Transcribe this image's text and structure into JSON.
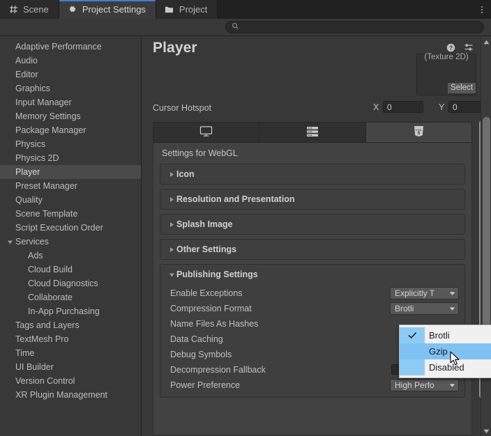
{
  "window": {
    "tabs": [
      {
        "label": "Scene",
        "icon": "grid-icon",
        "active": false
      },
      {
        "label": "Project Settings",
        "icon": "gear-icon",
        "active": true
      },
      {
        "label": "Project",
        "icon": "folder-icon",
        "active": false
      }
    ],
    "overflow_icon": "kebab-menu-icon"
  },
  "search": {
    "value": "",
    "placeholder": "",
    "icon": "search-icon"
  },
  "sidebar": {
    "items": [
      {
        "label": "Adaptive Performance",
        "indent": 0,
        "selected": false,
        "expandable": false
      },
      {
        "label": "Audio",
        "indent": 0,
        "selected": false,
        "expandable": false
      },
      {
        "label": "Editor",
        "indent": 0,
        "selected": false,
        "expandable": false
      },
      {
        "label": "Graphics",
        "indent": 0,
        "selected": false,
        "expandable": false
      },
      {
        "label": "Input Manager",
        "indent": 0,
        "selected": false,
        "expandable": false
      },
      {
        "label": "Memory Settings",
        "indent": 0,
        "selected": false,
        "expandable": false
      },
      {
        "label": "Package Manager",
        "indent": 0,
        "selected": false,
        "expandable": false
      },
      {
        "label": "Physics",
        "indent": 0,
        "selected": false,
        "expandable": false
      },
      {
        "label": "Physics 2D",
        "indent": 0,
        "selected": false,
        "expandable": false
      },
      {
        "label": "Player",
        "indent": 0,
        "selected": true,
        "expandable": false
      },
      {
        "label": "Preset Manager",
        "indent": 0,
        "selected": false,
        "expandable": false
      },
      {
        "label": "Quality",
        "indent": 0,
        "selected": false,
        "expandable": false
      },
      {
        "label": "Scene Template",
        "indent": 0,
        "selected": false,
        "expandable": false
      },
      {
        "label": "Script Execution Order",
        "indent": 0,
        "selected": false,
        "expandable": false
      },
      {
        "label": "Services",
        "indent": 0,
        "selected": false,
        "expandable": true,
        "expanded": true
      },
      {
        "label": "Ads",
        "indent": 1,
        "selected": false,
        "expandable": false
      },
      {
        "label": "Cloud Build",
        "indent": 1,
        "selected": false,
        "expandable": false
      },
      {
        "label": "Cloud Diagnostics",
        "indent": 1,
        "selected": false,
        "expandable": false
      },
      {
        "label": "Collaborate",
        "indent": 1,
        "selected": false,
        "expandable": false
      },
      {
        "label": "In-App Purchasing",
        "indent": 1,
        "selected": false,
        "expandable": false
      },
      {
        "label": "Tags and Layers",
        "indent": 0,
        "selected": false,
        "expandable": false
      },
      {
        "label": "TextMesh Pro",
        "indent": 0,
        "selected": false,
        "expandable": false
      },
      {
        "label": "Time",
        "indent": 0,
        "selected": false,
        "expandable": false
      },
      {
        "label": "UI Builder",
        "indent": 0,
        "selected": false,
        "expandable": false
      },
      {
        "label": "Version Control",
        "indent": 0,
        "selected": false,
        "expandable": false
      },
      {
        "label": "XR Plugin Management",
        "indent": 0,
        "selected": false,
        "expandable": false
      }
    ]
  },
  "main": {
    "title": "Player",
    "tools": [
      {
        "name": "help-icon",
        "label": "?"
      },
      {
        "name": "preset-icon",
        "label": ""
      },
      {
        "name": "kebab-menu-icon",
        "label": ""
      }
    ],
    "object_preview": {
      "type_label": "(Texture 2D)",
      "select_label": "Select"
    },
    "cursor_hotspot": {
      "label": "Cursor Hotspot",
      "x_label": "X",
      "x_value": "0",
      "y_label": "Y",
      "y_value": "0"
    },
    "platform_tabs": [
      {
        "name": "platform-standalone",
        "icon": "monitor-icon",
        "active": false
      },
      {
        "name": "platform-dedicated-server",
        "icon": "server-icon",
        "active": false
      },
      {
        "name": "platform-webgl",
        "icon": "html5-icon",
        "active": true
      }
    ],
    "settings_header": "Settings for WebGL",
    "sections": [
      {
        "label": "Icon",
        "expanded": false
      },
      {
        "label": "Resolution and Presentation",
        "expanded": false
      },
      {
        "label": "Splash Image",
        "expanded": false
      },
      {
        "label": "Other Settings",
        "expanded": false
      },
      {
        "label": "Publishing Settings",
        "expanded": true
      }
    ],
    "publishing_settings": [
      {
        "label": "Enable Exceptions",
        "control": "dropdown",
        "value": "Explicitly T"
      },
      {
        "label": "Compression Format",
        "control": "dropdown",
        "value": "Brotli"
      },
      {
        "label": "Name Files As Hashes",
        "control": "none",
        "value": ""
      },
      {
        "label": "Data Caching",
        "control": "none",
        "value": ""
      },
      {
        "label": "Debug Symbols",
        "control": "none",
        "value": ""
      },
      {
        "label": "Decompression Fallback",
        "control": "checkbox",
        "value": "unchecked"
      },
      {
        "label": "Power Preference",
        "control": "dropdown",
        "value": "High Perfo"
      }
    ]
  },
  "popup_menu": {
    "name": "compression-format-dropdown-menu",
    "items": [
      {
        "label": "Brotli",
        "checked": true,
        "highlighted": false
      },
      {
        "label": "Gzip",
        "checked": false,
        "highlighted": true
      },
      {
        "label": "Disabled",
        "checked": false,
        "highlighted": false
      }
    ]
  },
  "colors": {
    "accent_tab": "#3d7fd4",
    "menu_highlight": "#7fc2f2",
    "panel_bg": "#383838",
    "settings_bg": "#424242",
    "selected_sidebar": "#4a4a4a"
  }
}
